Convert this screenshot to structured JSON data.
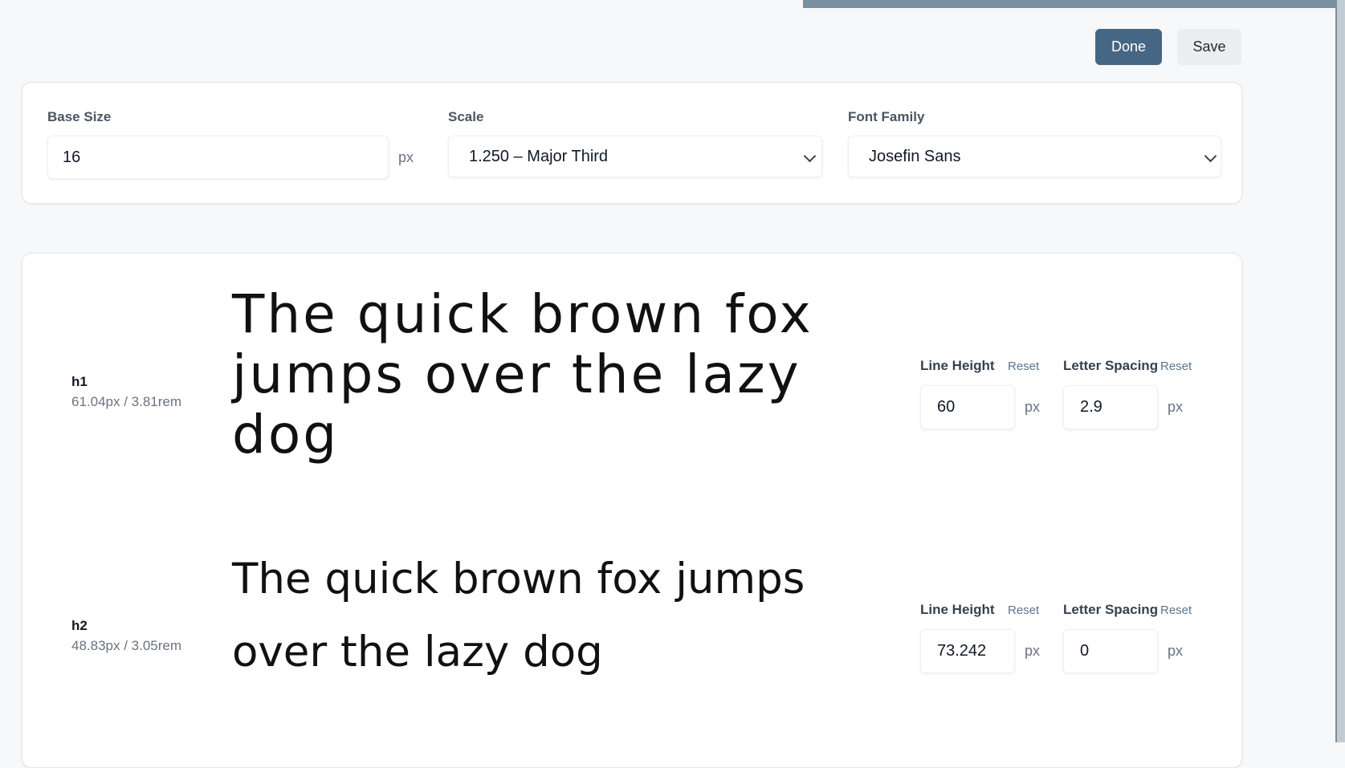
{
  "toolbar": {
    "done_label": "Done",
    "save_label": "Save"
  },
  "settings": {
    "base_size": {
      "label": "Base Size",
      "value": "16",
      "unit": "px"
    },
    "scale": {
      "label": "Scale",
      "value": "1.250 – Major Third"
    },
    "font_family": {
      "label": "Font Family",
      "value": "Josefin Sans"
    }
  },
  "rows": [
    {
      "tag": "h1",
      "meta": "61.04px / 3.81rem",
      "sample_lines": [
        "The quick brown fox",
        "jumps over the lazy",
        "dog"
      ],
      "line_height": {
        "label": "Line Height",
        "reset": "Reset",
        "value": "60",
        "unit": "px"
      },
      "letter_spacing": {
        "label": "Letter Spacing",
        "reset": "Reset",
        "value": "2.9",
        "unit": "px"
      }
    },
    {
      "tag": "h2",
      "meta": "48.83px / 3.05rem",
      "sample_lines": [
        "The quick brown fox jumps",
        "over the lazy dog"
      ],
      "line_height": {
        "label": "Line Height",
        "reset": "Reset",
        "value": "73.242",
        "unit": "px"
      },
      "letter_spacing": {
        "label": "Letter Spacing",
        "reset": "Reset",
        "value": "0",
        "unit": "px"
      }
    }
  ]
}
